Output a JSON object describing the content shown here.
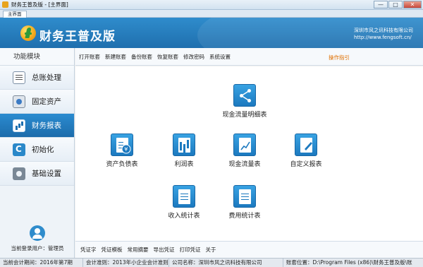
{
  "window": {
    "title": "财务王普及版 - [主界面]",
    "controls": {
      "minimize": "—",
      "maximize": "□",
      "close": "✕"
    }
  },
  "tab": {
    "label": "主界面"
  },
  "banner": {
    "app_name": "财务王普及版",
    "company_name": "深圳市风之讯科技有限公司",
    "company_url": "http://www.fengsoft.cn/"
  },
  "sidebar": {
    "header": "功能模块",
    "items": [
      {
        "label": "总账处理",
        "icon": "ledger-icon"
      },
      {
        "label": "固定资产",
        "icon": "asset-icon"
      },
      {
        "label": "财务报表",
        "icon": "report-icon",
        "active": true
      },
      {
        "label": "初始化",
        "icon": "init-icon"
      },
      {
        "label": "基础设置",
        "icon": "gear-icon"
      }
    ],
    "user_text": "当前登录用户：管理员"
  },
  "toolbar": {
    "items": [
      "打开账套",
      "新建账套",
      "备份账套",
      "恢复账套",
      "修改密码",
      "系统设置"
    ],
    "guide": "操作指引"
  },
  "reports": {
    "cashflow_detail": "现金流量明细表",
    "balance_sheet": "资产负债表",
    "income_statement": "利润表",
    "cashflow_statement": "现金流量表",
    "custom_report": "自定义报表",
    "revenue_stats": "收入统计表",
    "expense_stats": "费用统计表"
  },
  "bottom_toolbar": {
    "items": [
      "凭证字",
      "凭证模板",
      "常用摘要",
      "导出凭证",
      "打印凭证",
      "关于"
    ]
  },
  "status": {
    "period": "当前会计期间：2016年第7期",
    "standard": "会计准则：2013年小企业会计准则",
    "company": "公司名称：深圳市风之讯科技有限公司",
    "path": "账套位置：D:\\Program Files (x86)\\财务王普及版\\账"
  },
  "colors": {
    "accent": "#1f6fae",
    "banner": "#2f8ccc",
    "tile": "#1c79bf",
    "guide": "#e07000"
  }
}
